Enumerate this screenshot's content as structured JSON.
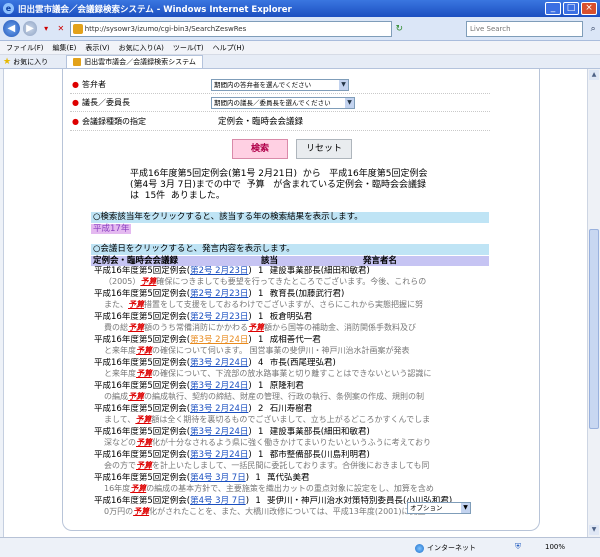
{
  "window": {
    "title": "旧出雲市議会／会議録検索システム - Windows Internet Explorer",
    "url": "http://sysowr3/izumo/cgi-bin3/SearchZeswRes",
    "search_placeholder": "Live Search"
  },
  "menu": [
    "ファイル(F)",
    "編集(E)",
    "表示(V)",
    "お気に入り(A)",
    "ツール(T)",
    "ヘルプ(H)"
  ],
  "favorites_label": "お気に入り",
  "tab_label": "旧出雲市議会／会議録検索システム",
  "form": {
    "rows": [
      {
        "label": "答弁者",
        "select": "期間内の答弁者を選んでください"
      },
      {
        "label": "議長／委員長",
        "select": "期間内の議長／委員長を選んでください"
      },
      {
        "label": "会議録種類の指定",
        "value": "定例会・臨時会会議録"
      }
    ],
    "search_button": "検索",
    "reset_button": "リセット"
  },
  "summary": "平成16年度第5回定例会(第1号 2月21日)  から   平成16年度第5回定例会\n(第4号 3月 7日)までの中で  予算   が含まれている定例会・臨時会会議録\nは  15件  ありました。",
  "year_notice": "○検索該当年をクリックすると、該当する年の検索結果を表示します。",
  "year_link": "平成17年",
  "date_notice": "○会議日をクリックすると、発言内容を表示します。",
  "table_headers": [
    "定例会・臨時会会議録",
    "該当",
    "発言者名"
  ],
  "records": [
    {
      "meeting": "平成16年度第5回定例会",
      "date": "第2号 2月23日",
      "count": "1",
      "speaker": "建設事業部長(細田和敏君)",
      "visited": false,
      "snippet_pre": "（2005）",
      "snippet_kw": "予算",
      "snippet_post": "確保につきましても要望を行ってきたところでございます。今後、これらの"
    },
    {
      "meeting": "平成16年度第5回定例会",
      "date": "第2号 2月23日",
      "count": "1",
      "speaker": "教育長(加藤武行君)",
      "visited": false,
      "snippet_pre": "また、",
      "snippet_kw": "予算",
      "snippet_post": "措置をして支援をしておるわけでございますが、さらにこれから実態把握に努"
    },
    {
      "meeting": "平成16年度第5回定例会",
      "date": "第2号 2月23日",
      "count": "1",
      "speaker": "板倉明弘君",
      "visited": false,
      "snippet_pre": "費の総",
      "snippet_kw": "予算",
      "snippet_post": "額のうち常備消防にかかわる",
      "snippet_kw2": "予算",
      "snippet_post2": "額から国等の補助金、消防関係手数料及び"
    },
    {
      "meeting": "平成16年度第5回定例会",
      "date": "第3号 2月24日",
      "count": "1",
      "speaker": "成相善代一君",
      "visited": true,
      "snippet_pre": "と来年度",
      "snippet_kw": "予算",
      "snippet_post": "の確保について伺います。   国営事業の斐伊川・神戸川治水計画案が発表"
    },
    {
      "meeting": "平成16年度第5回定例会",
      "date": "第3号 2月24日",
      "count": "4",
      "speaker": "市長(西尾理弘君)",
      "visited": false,
      "snippet_pre": "と来年度",
      "snippet_kw": "予算",
      "snippet_post": "の確保について、下流部の放水路事業と切り離すことはできないという認識に"
    },
    {
      "meeting": "平成16年度第5回定例会",
      "date": "第3号 2月24日",
      "count": "1",
      "speaker": "原隆利君",
      "visited": false,
      "snippet_pre": "の編成",
      "snippet_kw": "予算",
      "snippet_post": "の編成執行、契約の締結、財産の管理、行政の執行、条例案の作成、規則の制"
    },
    {
      "meeting": "平成16年度第5回定例会",
      "date": "第3号 2月24日",
      "count": "2",
      "speaker": "石川寿樹君",
      "visited": false,
      "snippet_pre": "まして、",
      "snippet_kw": "予算",
      "snippet_post": "額は全く期待を裏切るものでございまして、立ち上がるどころかすくんでしま"
    },
    {
      "meeting": "平成16年度第5回定例会",
      "date": "第3号 2月24日",
      "count": "1",
      "speaker": "建設事業部長(細田和敏君)",
      "visited": false,
      "snippet_pre": "深などの",
      "snippet_kw": "予算",
      "snippet_post": "化が十分なされるよう県に強く働きかけてまいりたいというふうに考えており"
    },
    {
      "meeting": "平成16年度第5回定例会",
      "date": "第3号 2月24日",
      "count": "1",
      "speaker": "都市整備部長(川島利明君)",
      "visited": false,
      "snippet_pre": "会の方で",
      "snippet_kw": "予算",
      "snippet_post": "を計上いたしまして、一括民間に委託しております。合併後におきましても同"
    },
    {
      "meeting": "平成16年度第5回定例会",
      "date": "第4号 3月 7日",
      "count": "1",
      "speaker": "萬代弘美君",
      "visited": false,
      "snippet_pre": "16年度",
      "snippet_kw": "予算",
      "snippet_post": "の編成の基本方針で、主要施策を織出カットの重点対象に設定をし、加算を含め"
    },
    {
      "meeting": "平成16年度第5回定例会",
      "date": "第4号 3月 7日",
      "count": "1",
      "speaker": "斐伊川・神戸川治水対策特別委員長(小川弘和君)",
      "visited": false,
      "snippet_pre": "0万円の",
      "snippet_kw": "予算",
      "snippet_post": "化がされたことを、また、大橋川改修については、平成13年度(2001)に測量"
    }
  ],
  "option_select": "オプション",
  "status": {
    "zone": "インターネット",
    "zoom": "100%"
  }
}
